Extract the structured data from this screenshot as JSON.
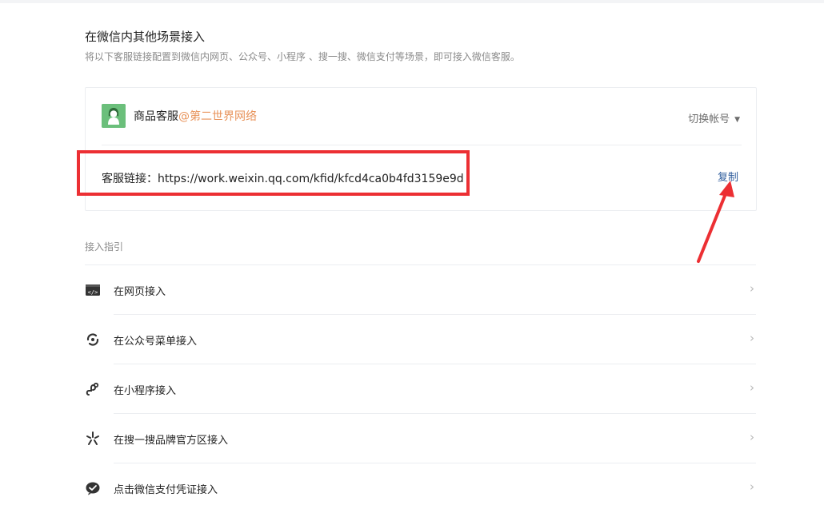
{
  "section": {
    "title": "在微信内其他场景接入",
    "description": "将以下客服链接配置到微信内网页、公众号、小程序 、搜一搜、微信支付等场景，即可接入微信客服。"
  },
  "account": {
    "name": "商品客服",
    "corp": "@第二世界网络",
    "switch_label": "切换帐号",
    "avatar_color": "#6bbf7b"
  },
  "link": {
    "label": "客服链接：",
    "url": "https://work.weixin.qq.com/kfid/kfcd4ca0b4fd3159e9d",
    "copy_label": "复制"
  },
  "guide": {
    "label": "接入指引",
    "items": [
      {
        "label": "在网页接入",
        "icon": "web-code-icon"
      },
      {
        "label": "在公众号菜单接入",
        "icon": "official-account-icon"
      },
      {
        "label": "在小程序接入",
        "icon": "mini-program-icon"
      },
      {
        "label": "在搜一搜品牌官方区接入",
        "icon": "search-sparkle-icon"
      },
      {
        "label": "点击微信支付凭证接入",
        "icon": "wechat-pay-icon"
      }
    ]
  },
  "colors": {
    "annotation_red": "#ec2f33",
    "link_blue": "#2e5c9c",
    "corp_orange": "#e8935a"
  }
}
